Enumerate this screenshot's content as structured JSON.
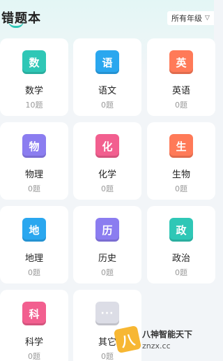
{
  "header": {
    "title": "错题本",
    "grade_select": "所有年级"
  },
  "subjects": [
    {
      "icon_text": "数",
      "name": "数学",
      "count": "10题",
      "icon_name": "math-icon",
      "color": "#2fc7b6"
    },
    {
      "icon_text": "语",
      "name": "语文",
      "count": "0题",
      "icon_name": "chinese-icon",
      "color": "#2aa7ef"
    },
    {
      "icon_text": "英",
      "name": "英语",
      "count": "0题",
      "icon_name": "english-icon",
      "color": "#ff7a58"
    },
    {
      "icon_text": "物",
      "name": "物理",
      "count": "0题",
      "icon_name": "physics-icon",
      "color": "#8b7df0"
    },
    {
      "icon_text": "化",
      "name": "化学",
      "count": "0题",
      "icon_name": "chemistry-icon",
      "color": "#f25f8f"
    },
    {
      "icon_text": "生",
      "name": "生物",
      "count": "0题",
      "icon_name": "biology-icon",
      "color": "#ff7a58"
    },
    {
      "icon_text": "地",
      "name": "地理",
      "count": "0题",
      "icon_name": "geography-icon",
      "color": "#2aa7ef"
    },
    {
      "icon_text": "历",
      "name": "历史",
      "count": "0题",
      "icon_name": "history-icon",
      "color": "#8b7df0"
    },
    {
      "icon_text": "政",
      "name": "政治",
      "count": "0题",
      "icon_name": "politics-icon",
      "color": "#2fc7b6"
    },
    {
      "icon_text": "科",
      "name": "科学",
      "count": "0题",
      "icon_name": "science-icon",
      "color": "#f25f8f"
    },
    {
      "icon_text": "···",
      "name": "其它",
      "count": "0题",
      "icon_name": "more-icon",
      "color": "#dcdde6"
    }
  ],
  "watermark": {
    "logo": "八",
    "line1": "八神智能天下",
    "line2": "znzx.cc"
  }
}
